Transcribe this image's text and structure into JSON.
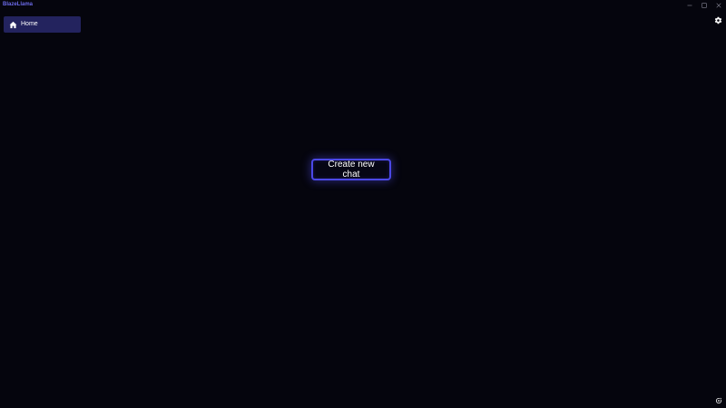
{
  "window": {
    "title": "BlazeLlama",
    "controls": {
      "minimize": "minimize-icon",
      "maximize": "maximize-icon",
      "close": "close-icon"
    }
  },
  "sidebar": {
    "items": [
      {
        "label": "Home",
        "icon": "home-icon",
        "selected": true
      }
    ]
  },
  "header": {
    "settings_icon": "gear-icon"
  },
  "main": {
    "create_chat_label": "Create new chat"
  },
  "footer": {
    "corner_icon": "refresh-icon"
  },
  "colors": {
    "background": "#05050d",
    "accent": "#4b48e6",
    "title": "#6b6ae8",
    "nav_selected": "#23235e",
    "text": "#ffffff"
  }
}
